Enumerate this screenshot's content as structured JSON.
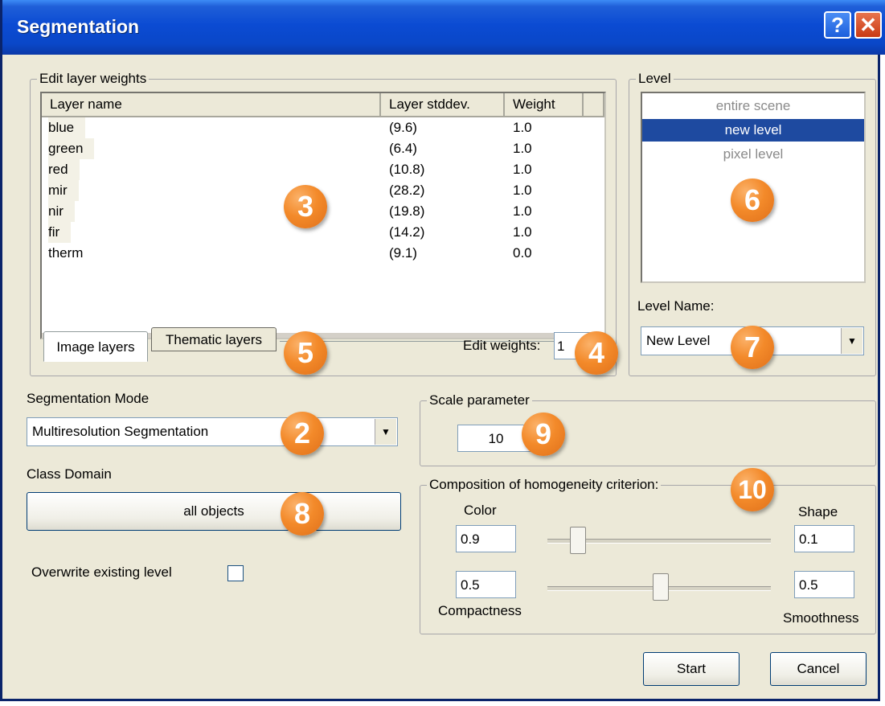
{
  "window": {
    "title": "Segmentation",
    "help_label": "?",
    "close_label": "✕"
  },
  "layers": {
    "legend": "Edit layer weights",
    "columns": [
      "Layer name",
      "Layer stddev.",
      "Weight"
    ],
    "rows": [
      {
        "name": "blue",
        "stddev": "(9.6)",
        "weight": "1.0"
      },
      {
        "name": "green",
        "stddev": "(6.4)",
        "weight": "1.0"
      },
      {
        "name": "red",
        "stddev": "(10.8)",
        "weight": "1.0"
      },
      {
        "name": "mir",
        "stddev": "(28.2)",
        "weight": "1.0"
      },
      {
        "name": "nir",
        "stddev": "(19.8)",
        "weight": "1.0"
      },
      {
        "name": "fir",
        "stddev": "(14.2)",
        "weight": "1.0"
      },
      {
        "name": "therm",
        "stddev": "(9.1)",
        "weight": "0.0"
      }
    ],
    "tabs": [
      "Image layers",
      "Thematic layers"
    ],
    "edit_weights_label": "Edit weights:",
    "edit_weights_value": "1"
  },
  "level": {
    "legend": "Level",
    "items": [
      "entire scene",
      "new level",
      "pixel level"
    ],
    "selected": "new level",
    "name_label": "Level Name:",
    "name_value": "New Level"
  },
  "segmentation_mode": {
    "label": "Segmentation Mode",
    "value": "Multiresolution Segmentation"
  },
  "class_domain": {
    "label": "Class Domain",
    "button_label": "all objects"
  },
  "overwrite": {
    "label": "Overwrite existing level",
    "checked": false
  },
  "scale": {
    "legend": "Scale parameter",
    "value": "10"
  },
  "homogeneity": {
    "legend": "Composition of homogeneity criterion:",
    "color_label": "Color",
    "shape_label": "Shape",
    "color_value": "0.9",
    "shape_value": "0.1",
    "compactness_value": "0.5",
    "smoothness_value": "0.5",
    "compactness_label": "Compactness",
    "smoothness_label": "Smoothness",
    "color_shape_slider": 0.1,
    "compactness_smoothness_slider": 0.5
  },
  "actions": {
    "start_label": "Start",
    "cancel_label": "Cancel"
  },
  "badges": [
    "2",
    "3",
    "4",
    "5",
    "6",
    "7",
    "8",
    "9",
    "10"
  ],
  "colors": {
    "title_bar": "#0b4bd3",
    "badge": "#f38a2a",
    "selection": "#1e4aa0",
    "dialog_bg": "#ece9d8"
  }
}
